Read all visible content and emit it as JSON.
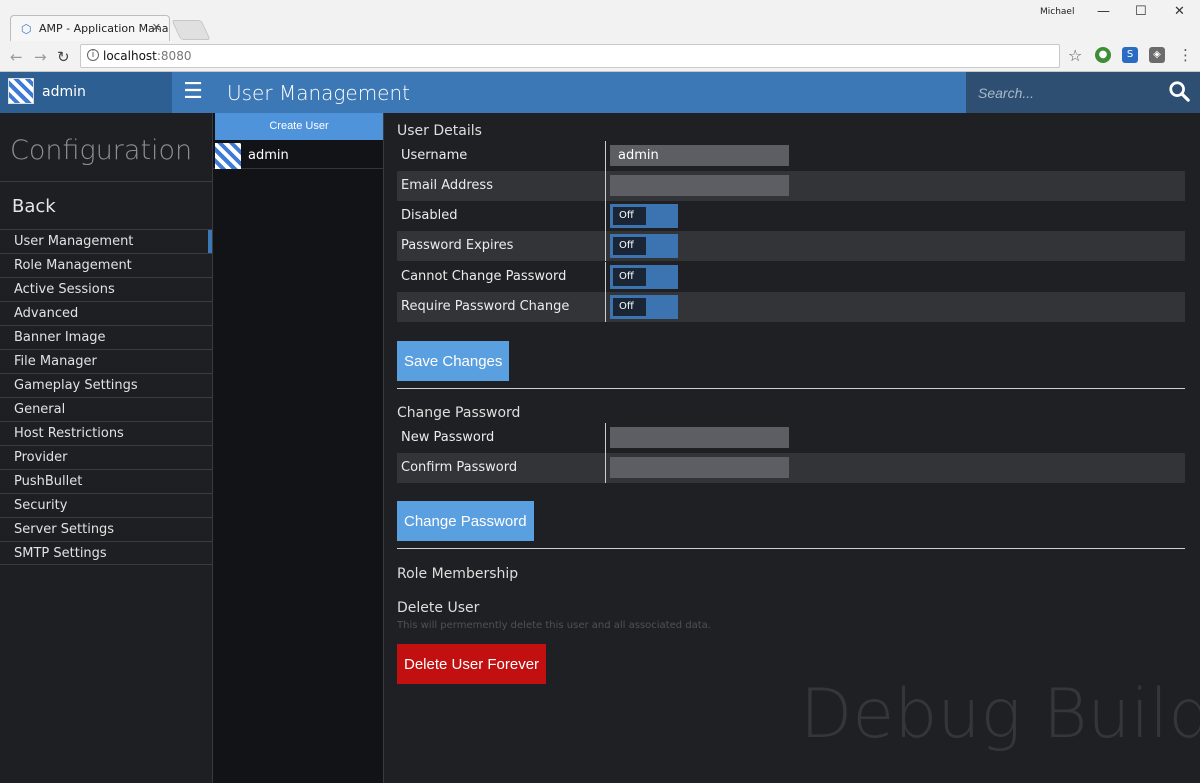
{
  "browser": {
    "tab_title": "AMP - Application Mana",
    "window_user": "Michael",
    "url_host": "localhost",
    "url_port": ":8080"
  },
  "header": {
    "user": "admin",
    "title": "User Management",
    "search_placeholder": "Search..."
  },
  "sidebar": {
    "heading": "Configuration",
    "back": "Back",
    "items": [
      {
        "label": "User Management"
      },
      {
        "label": "Role Management"
      },
      {
        "label": "Active Sessions"
      },
      {
        "label": "Advanced"
      },
      {
        "label": "Banner Image"
      },
      {
        "label": "File Manager"
      },
      {
        "label": "Gameplay Settings"
      },
      {
        "label": "General"
      },
      {
        "label": "Host Restrictions"
      },
      {
        "label": "Provider"
      },
      {
        "label": "PushBullet"
      },
      {
        "label": "Security"
      },
      {
        "label": "Server Settings"
      },
      {
        "label": "SMTP Settings"
      }
    ]
  },
  "users": {
    "create_label": "Create User",
    "list": [
      {
        "name": "admin"
      }
    ]
  },
  "details": {
    "title": "User Details",
    "username_label": "Username",
    "username_value": "admin",
    "email_label": "Email Address",
    "email_value": "",
    "disabled_label": "Disabled",
    "password_expires_label": "Password Expires",
    "cannot_change_label": "Cannot Change Password",
    "require_change_label": "Require Password Change",
    "toggle_off": "Off",
    "save_label": "Save Changes"
  },
  "change_password": {
    "title": "Change Password",
    "new_label": "New Password",
    "confirm_label": "Confirm Password",
    "button_label": "Change Password"
  },
  "roles": {
    "title": "Role Membership"
  },
  "delete": {
    "title": "Delete User",
    "hint": "This will permemently delete this user and all associated data.",
    "button_label": "Delete User Forever"
  },
  "watermark": "Debug Build",
  "colors": {
    "accent": "#3c78b6",
    "button": "#5a9fe0",
    "danger": "#c21011"
  }
}
